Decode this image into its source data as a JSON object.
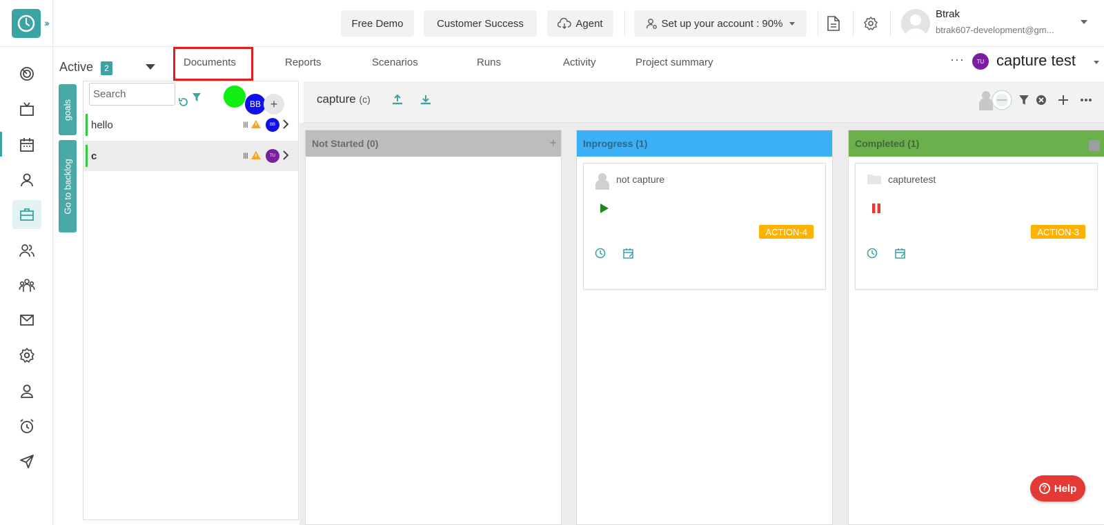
{
  "header": {
    "free_demo": "Free Demo",
    "customer_success": "Customer Success",
    "agent": "Agent",
    "setup": "Set up your account : 90%",
    "user_name": "Btrak",
    "user_email": "btrak607-development@gm..."
  },
  "rail": {
    "items": [
      "dashboard-icon",
      "tv-icon",
      "calendar-icon",
      "user-icon",
      "briefcase-icon",
      "users-icon",
      "team-icon",
      "mail-icon",
      "settings-icon",
      "profile-icon",
      "alarm-icon",
      "send-icon"
    ],
    "active": "briefcase-icon"
  },
  "toolbar": {
    "status_label": "Active",
    "status_count": "2",
    "tabs": [
      "Documents",
      "Reports",
      "Scenarios",
      "Runs",
      "Activity",
      "Project summary"
    ],
    "highlighted_tab": "Documents",
    "project_initials": "TU",
    "project_name": "capture test"
  },
  "side_tabs": {
    "goals": "goals",
    "backlog": "Go to backlog"
  },
  "goals_panel": {
    "search_placeholder": "Search",
    "member_initials": "BB",
    "add_label": "+",
    "goals": [
      {
        "name": "hello",
        "avatar": "BB",
        "avatar_color": "#1010ee",
        "priority": "III"
      },
      {
        "name": "c",
        "avatar": "TU",
        "avatar_color": "#7b1fa2",
        "priority": "III"
      }
    ]
  },
  "board": {
    "goal_title": "capture",
    "goal_code": "(c)",
    "columns": [
      {
        "title": "Not Started (0)",
        "color": "#bdbdbd",
        "cards": []
      },
      {
        "title": "Inprogress (1)",
        "color": "#3bb0f5",
        "cards": [
          {
            "title": "not capture",
            "tag": "ACTION-4",
            "state": "play"
          }
        ]
      },
      {
        "title": "Completed (1)",
        "color": "#6ab04c",
        "cards": [
          {
            "title": "capturetest",
            "tag": "ACTION-3",
            "state": "pause"
          }
        ]
      }
    ]
  },
  "help": {
    "label": "Help"
  },
  "colors": {
    "accent": "#3aa3a3",
    "highlight_box": "#e02020",
    "tag": "#ffb300"
  }
}
